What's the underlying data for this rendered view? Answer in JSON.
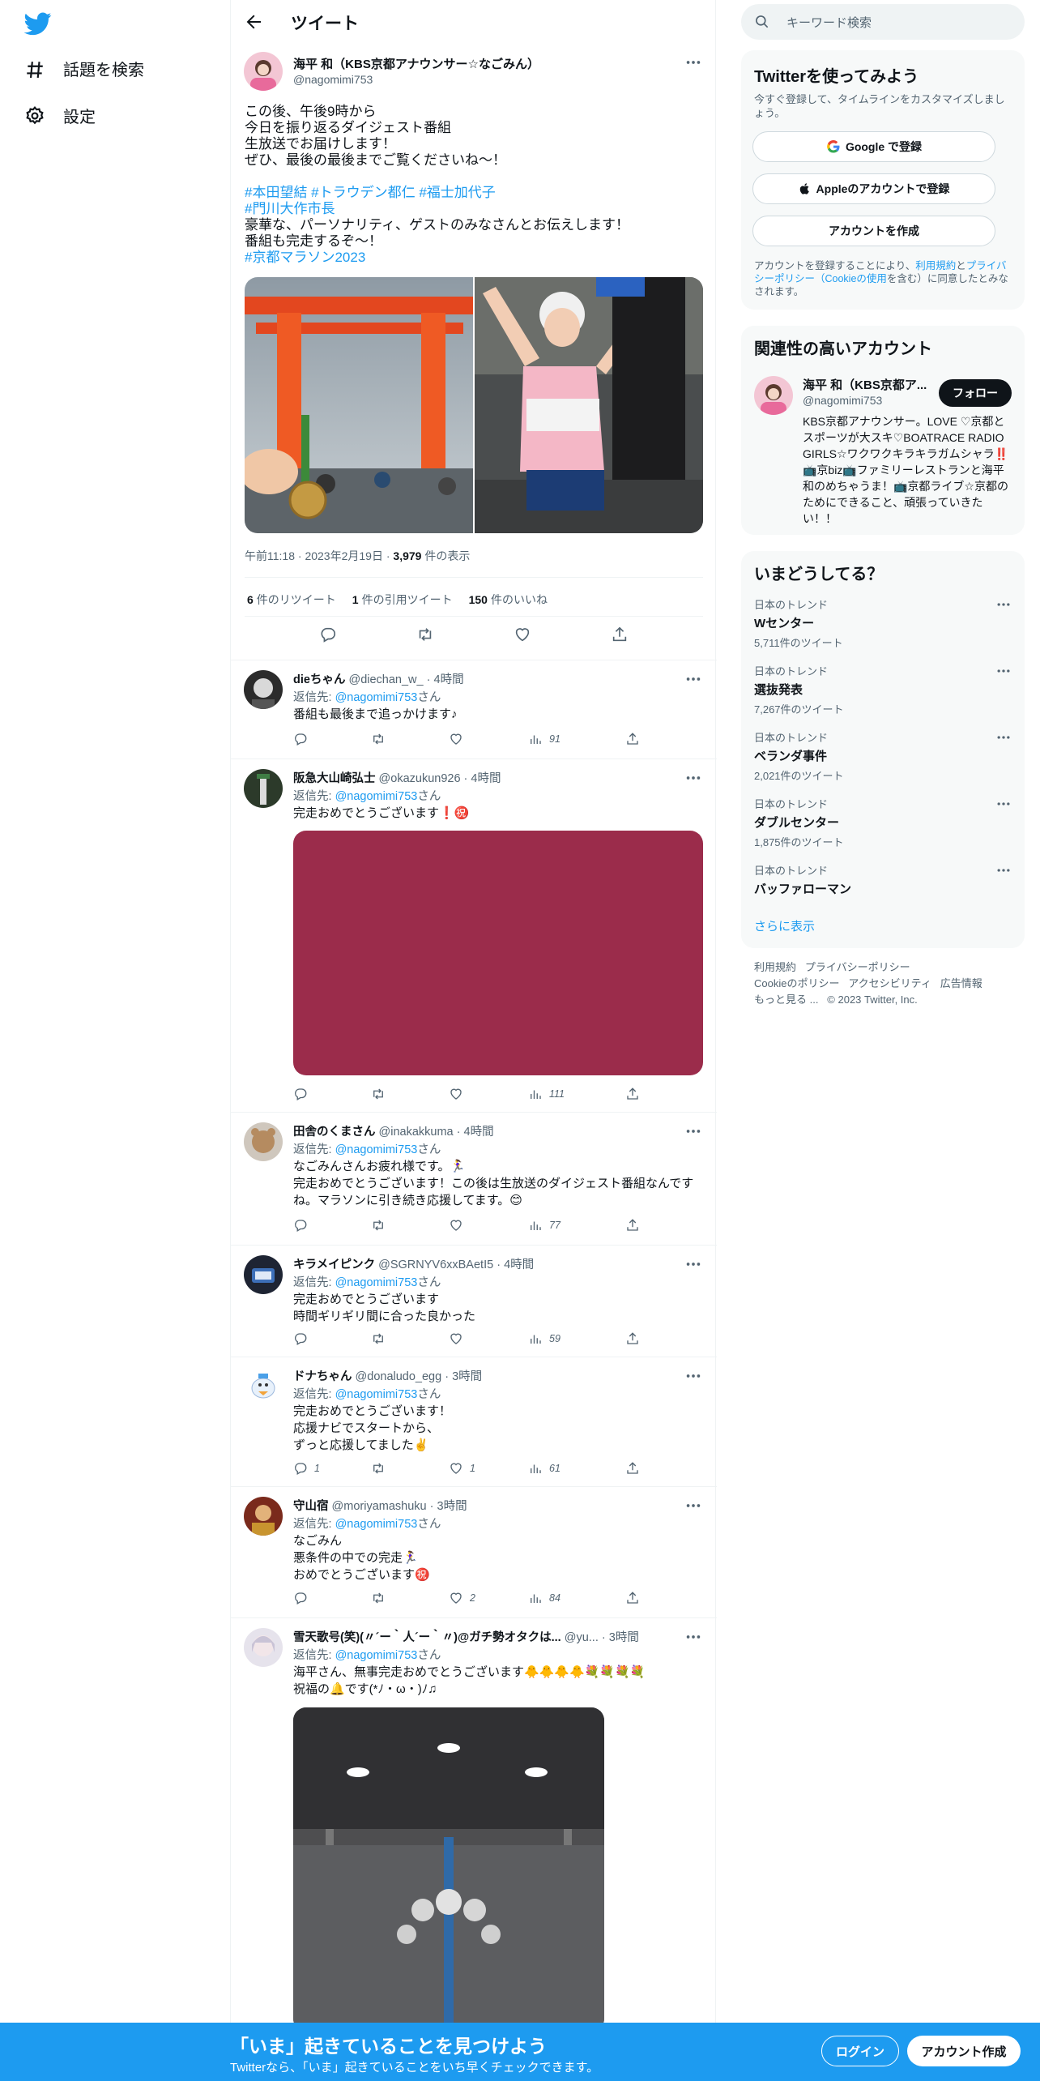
{
  "nav": {
    "explore_label": "話題を検索",
    "settings_label": "設定"
  },
  "header": {
    "title": "ツイート"
  },
  "main_tweet": {
    "name": "海平 和（KBS京都アナウンサー☆なごみん）",
    "handle": "@nagomimi753",
    "text": "この後、午後9時から\n今日を振り返るダイジェスト番組\n生放送でお届けします！\nぜひ、最後の最後までご覧くださいね〜！",
    "tags1": "#本田望結 #トラウデン都仁 #福士加代子",
    "tags2": "#門川大作市長",
    "text2": "豪華な、パーソナリティ、ゲストのみなさんとお伝えします！\n番組も完走するぞ〜！",
    "tags3": "#京都マラソン2023",
    "time": "午前11:18",
    "date": "2023年2月19日",
    "views_count": "3,979",
    "views_label": "件の表示",
    "retweets_count": "6",
    "retweets_label": "件のリツイート",
    "quotes_count": "1",
    "quotes_label": "件の引用ツイート",
    "likes_count": "150",
    "likes_label": "件のいいね"
  },
  "replies": [
    {
      "name": "dieちゃん",
      "handle": "@diechan_w_",
      "time": "4時間",
      "to_prefix": "返信先:",
      "to_handle": "@nagomimi753",
      "to_suffix": "さん",
      "text": "番組も最後まで追っかけます♪",
      "reply": "",
      "retweet": "",
      "like": "",
      "views": "91"
    },
    {
      "name": "阪急大山崎弘士",
      "handle": "@okazukun926",
      "time": "4時間",
      "to_prefix": "返信先:",
      "to_handle": "@nagomimi753",
      "to_suffix": "さん",
      "text": "完走おめでとうございます❗️㊗️",
      "reply": "",
      "retweet": "",
      "like": "",
      "views": "111"
    },
    {
      "name": "田舎のくまさん",
      "handle": "@inakakkuma",
      "time": "4時間",
      "to_prefix": "返信先:",
      "to_handle": "@nagomimi753",
      "to_suffix": "さん",
      "text": "なごみんさんお疲れ様です。🏃‍♀️\n完走おめでとうございます！この後は生放送のダイジェスト番組なんですね。マラソンに引き続き応援してます。😊",
      "reply": "",
      "retweet": "",
      "like": "",
      "views": "77"
    },
    {
      "name": "キラメイピンク",
      "handle": "@SGRNYV6xxBAetI5",
      "time": "4時間",
      "to_prefix": "返信先:",
      "to_handle": "@nagomimi753",
      "to_suffix": "さん",
      "text": "完走おめでとうございます\n時間ギリギリ間に合った良かった",
      "reply": "",
      "retweet": "",
      "like": "",
      "views": "59"
    },
    {
      "name": "ドナちゃん",
      "handle": "@donaludo_egg",
      "time": "3時間",
      "to_prefix": "返信先:",
      "to_handle": "@nagomimi753",
      "to_suffix": "さん",
      "text": "完走おめでとうございます！\n応援ナビでスタートから、\nずっと応援してました✌️",
      "reply": "1",
      "retweet": "",
      "like": "1",
      "views": "61"
    },
    {
      "name": "守山宿",
      "handle": "@moriyamashuku",
      "time": "3時間",
      "to_prefix": "返信先:",
      "to_handle": "@nagomimi753",
      "to_suffix": "さん",
      "text": "なごみん\n悪条件の中での完走🏃‍♀️\nおめでとうございます㊗️",
      "reply": "",
      "retweet": "",
      "like": "2",
      "views": "84"
    },
    {
      "name": "雪天歌号(笑)(〃´ー｀人´ー｀〃)@ガチ勢オタクは...",
      "handle": "@yu...",
      "time": "3時間",
      "to_prefix": "返信先:",
      "to_handle": "@nagomimi753",
      "to_suffix": "さん",
      "text": "海平さん、無事完走おめでとうございます🐥🐥🐥🐥💐💐💐💐\n祝福の🔔です(*ﾉ・ω・)ﾉ♫",
      "reply": "",
      "retweet": "",
      "like": "",
      "views": ""
    }
  ],
  "sidebar": {
    "search_placeholder": "キーワード検索",
    "signup": {
      "title": "Twitterを使ってみよう",
      "desc": "今すぐ登録して、タイムラインをカスタマイズしましょう。",
      "google": "Google で登録",
      "apple": "Appleのアカウントで登録",
      "create": "アカウントを作成",
      "terms_1": "アカウントを登録することにより、",
      "terms_link1": "利用規約",
      "terms_2": "と",
      "terms_link2": "プライバシーポリシー（Cookieの使用",
      "terms_3": "を含む）に同意したとみなされます。"
    },
    "related": {
      "title": "関連性の高いアカウント",
      "name": "海平 和（KBS京都ア...",
      "handle": "@nagomimi753",
      "follow": "フォロー",
      "bio": "KBS京都アナウンサー。LOVE ♡京都とスポーツが大スキ♡BOATRACE RADIO GIRLS☆ワクワクキラキラガムシャラ‼️ 📺京biz📺ファミリーレストランと海平和のめちゃうま！📺京都ライブ☆京都のためにできること、頑張っていきたい！！"
    },
    "trends": {
      "title": "いまどうしてる？",
      "items": [
        {
          "context": "日本のトレンド",
          "name": "Wセンター",
          "count": "5,711件のツイート"
        },
        {
          "context": "日本のトレンド",
          "name": "選抜発表",
          "count": "7,267件のツイート"
        },
        {
          "context": "日本のトレンド",
          "name": "ベランダ事件",
          "count": "2,021件のツイート"
        },
        {
          "context": "日本のトレンド",
          "name": "ダブルセンター",
          "count": "1,875件のツイート"
        },
        {
          "context": "日本のトレンド",
          "name": "バッファローマン",
          "count": ""
        }
      ],
      "show_more": "さらに表示"
    },
    "footer": {
      "terms": "利用規約",
      "privacy": "プライバシーポリシー",
      "cookie": "Cookieのポリシー",
      "accessibility": "アクセシビリティ",
      "ads": "広告情報",
      "more": "もっと見る ...",
      "copyright": "© 2023 Twitter, Inc."
    }
  },
  "bottom_bar": {
    "title": "「いま」起きていることを見つけよう",
    "subtitle": "Twitterなら、「いま」起きていることをいち早くチェックできます。",
    "login": "ログイン",
    "signup": "アカウント作成"
  },
  "colors": {
    "accent": "#1d9bf0",
    "text": "#0f1419",
    "muted": "#536471"
  }
}
